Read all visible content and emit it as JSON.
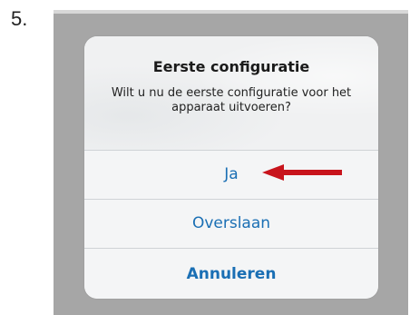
{
  "step": {
    "number": "5."
  },
  "dialog": {
    "title": "Eerste configuratie",
    "message": "Wilt u nu de eerste configuratie voor het apparaat uitvoeren?",
    "buttons": [
      {
        "label": "Ja"
      },
      {
        "label": "Overslaan"
      },
      {
        "label": "Annuleren"
      }
    ]
  },
  "colors": {
    "accent": "#1a6fb4",
    "arrow": "#c8141c",
    "backdrop": "#a6a6a6"
  },
  "annotation": {
    "icon": "arrow-left-icon"
  }
}
